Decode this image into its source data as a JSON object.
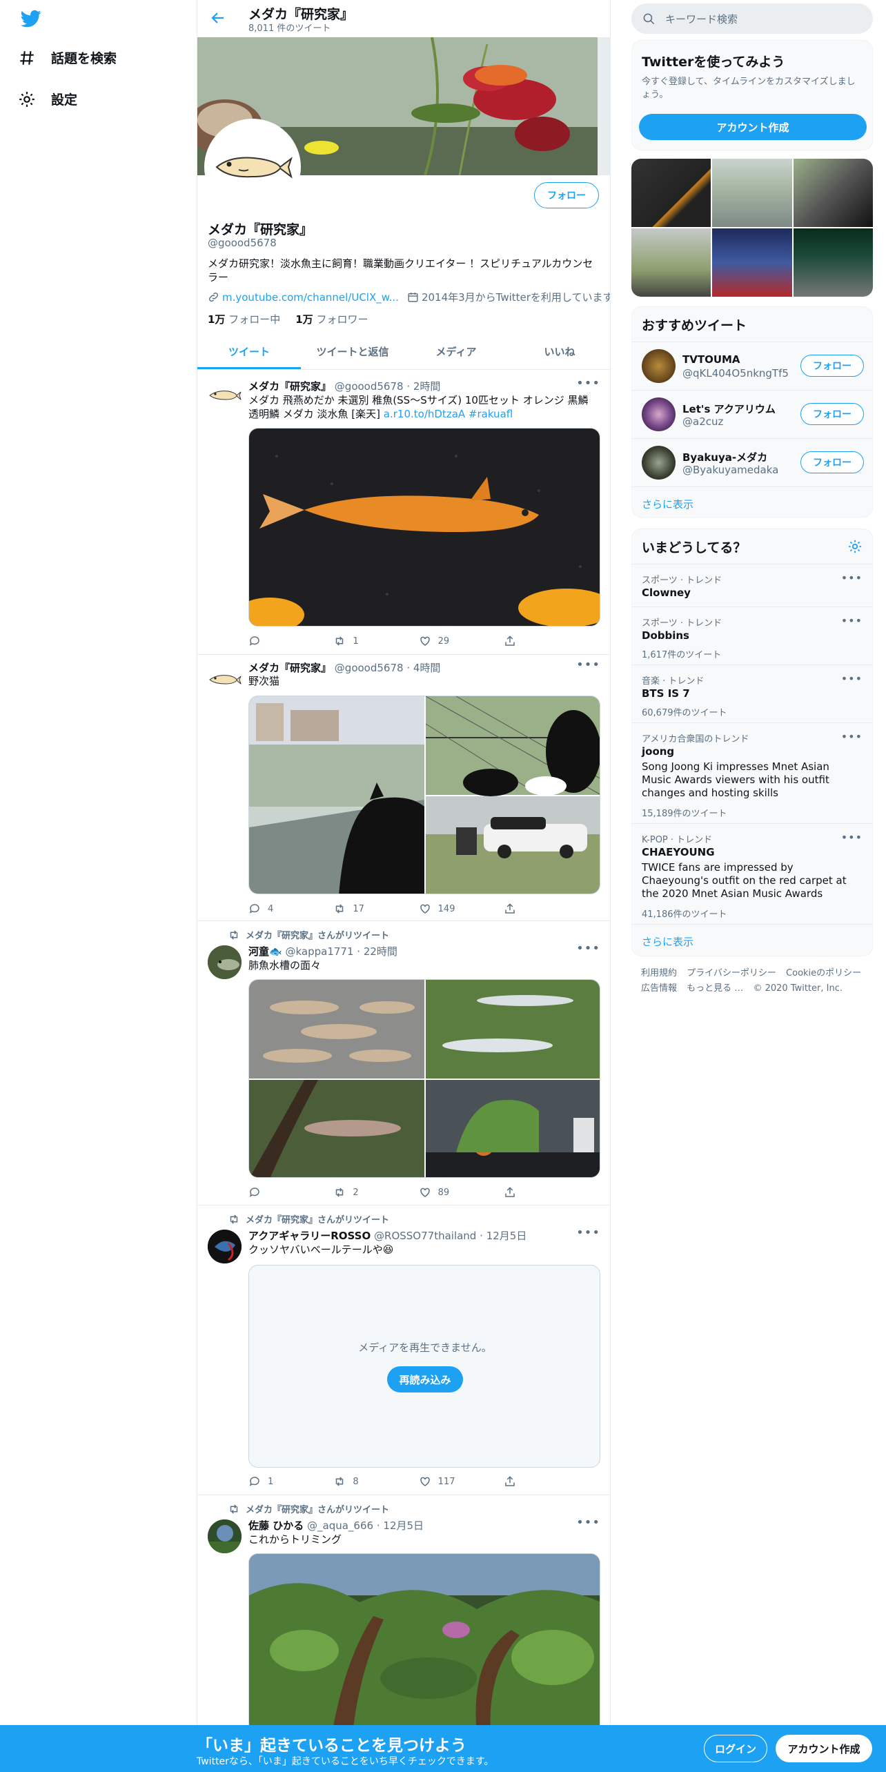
{
  "nav": {
    "logo_icon": "twitter-bird-icon",
    "items": [
      {
        "label": "話題を検索",
        "icon": "hashtag-icon"
      },
      {
        "label": "設定",
        "icon": "gear-icon"
      }
    ]
  },
  "header": {
    "title": "メダカ『研究家』",
    "subtitle": "8,011 件のツイート"
  },
  "profile": {
    "name": "メダカ『研究家』",
    "handle": "@goood5678",
    "bio": "メダカ研究家！淡水魚主に飼育！職業動画クリエイター ！スピリチュアルカウンセラー",
    "link": "m.youtube.com/channel/UClX_w...",
    "joined": "2014年3月からTwitterを利用しています",
    "following_count": "1万",
    "following_label": "フォロー中",
    "followers_count": "1万",
    "followers_label": "フォロワー",
    "follow_label": "フォロー"
  },
  "tabs": [
    "ツイート",
    "ツイートと返信",
    "メディア",
    "いいね"
  ],
  "tweets": [
    {
      "name": "メダカ『研究家』",
      "handle": "@goood5678",
      "time": "2時間",
      "text": "メダカ 飛燕めだか 未選別 稚魚(SS〜Sサイズ) 10匹セット オレンジ 黒鱗 透明鱗 メダカ 淡水魚 [楽天] ",
      "link": "a.r10.to/hDtzaA #rakuafl",
      "reply": "",
      "retweet": "1",
      "like": "29"
    },
    {
      "name": "メダカ『研究家』",
      "handle": "@goood5678",
      "time": "4時間",
      "text": "野次猫",
      "reply": "4",
      "retweet": "17",
      "like": "149"
    },
    {
      "retweet_label": "メダカ『研究家』さんがリツイート",
      "name": "河童🐟",
      "handle": "@kappa1771",
      "time": "22時間",
      "text": "肺魚水槽の面々",
      "reply": "",
      "retweet": "2",
      "like": "89"
    },
    {
      "retweet_label": "メダカ『研究家』さんがリツイート",
      "name": "アクアギャラリーROSSO",
      "handle": "@ROSSO77thailand",
      "time": "12月5日",
      "text": "クッソヤバいベールテールや😆",
      "media_error": "メディアを再生できません。",
      "reload_label": "再読み込み",
      "reply": "1",
      "retweet": "8",
      "like": "117"
    },
    {
      "retweet_label": "メダカ『研究家』さんがリツイート",
      "name": "佐藤 ひかる",
      "handle": "@_aqua_666",
      "time": "12月5日",
      "text": "これからトリミング"
    }
  ],
  "sidebar": {
    "search_placeholder": "キーワード検索",
    "signup_card": {
      "title": "Twitterを使ってみよう",
      "text": "今すぐ登録して、タイムラインをカスタマイズしましょう。",
      "button": "アカウント作成"
    },
    "recommended": {
      "title": "おすすめツイート",
      "users": [
        {
          "name": "TVTOUMA",
          "handle": "@qKL404O5nkngTf5"
        },
        {
          "name": "Let's アクアリウム",
          "handle": "@a2cuz"
        },
        {
          "name": "Byakuya-メダカ",
          "handle": "@Byakuyamedaka"
        }
      ],
      "follow_label": "フォロー",
      "more": "さらに表示"
    },
    "trends": {
      "title": "いまどうしてる？",
      "items": [
        {
          "category": "スポーツ · トレンド",
          "title": "Clowney",
          "desc": "",
          "count": ""
        },
        {
          "category": "スポーツ · トレンド",
          "title": "Dobbins",
          "desc": "",
          "count": "1,617件のツイート"
        },
        {
          "category": "音楽 · トレンド",
          "title": "BTS IS 7",
          "desc": "",
          "count": "60,679件のツイート"
        },
        {
          "category": "アメリカ合衆国のトレンド",
          "title": "joong",
          "desc": "Song Joong Ki impresses Mnet Asian Music Awards viewers with his outfit changes and hosting skills",
          "count": "15,189件のツイート"
        },
        {
          "category": "K-POP · トレンド",
          "title": "CHAEYOUNG",
          "desc": "TWICE fans are impressed by Chaeyoung's outfit on the red carpet at the 2020 Mnet Asian Music Awards",
          "count": "41,186件のツイート"
        }
      ],
      "more": "さらに表示"
    },
    "footer": {
      "line1": [
        "利用規約",
        "プライバシーポリシー",
        "Cookieのポリシー"
      ],
      "line2": [
        "広告情報",
        "もっと見る …",
        "© 2020 Twitter, Inc."
      ]
    }
  },
  "bottom_bar": {
    "title": "「いま」起きていることを見つけよう",
    "subtitle": "Twitterなら、「いま」起きていることをいち早くチェックできます。",
    "login": "ログイン",
    "signup": "アカウント作成"
  },
  "colors": {
    "accent": "#1da1f2",
    "text": "#0f1419",
    "muted": "#5b7083"
  }
}
